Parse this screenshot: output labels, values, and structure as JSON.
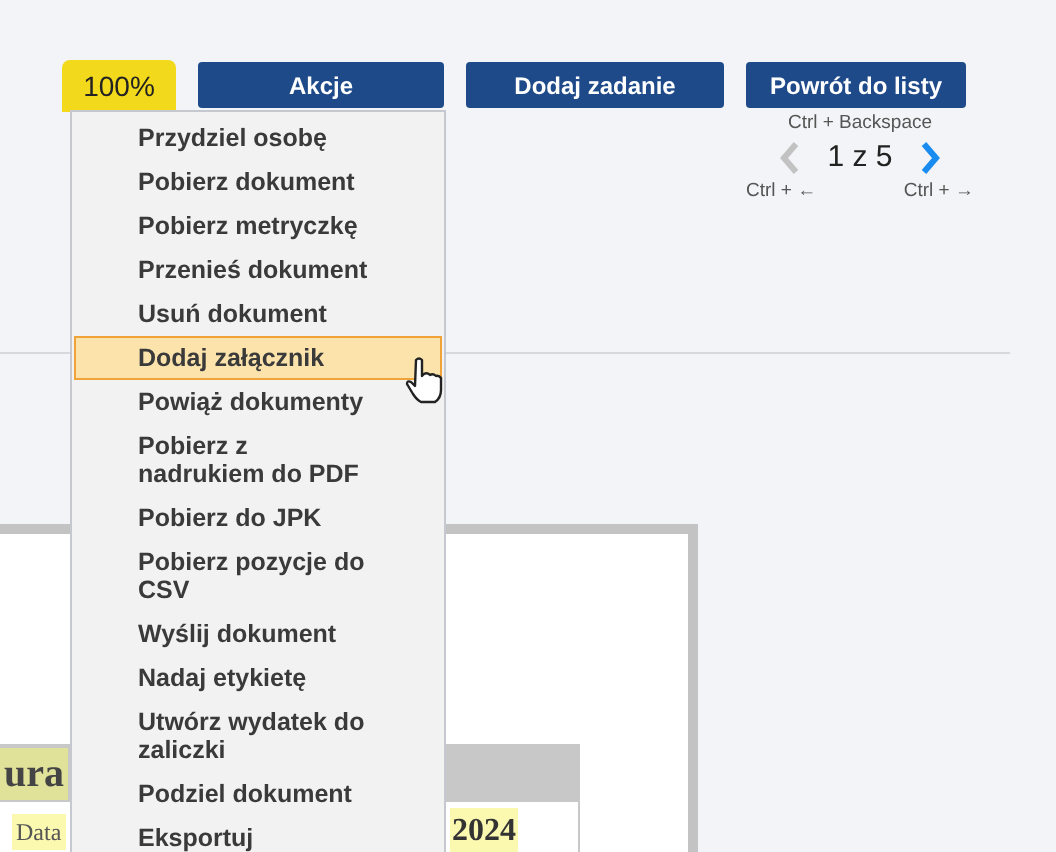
{
  "zoom": {
    "label": "100%"
  },
  "toolbar_buttons": [
    {
      "label": "Akcje"
    },
    {
      "label": "Dodaj zadanie"
    },
    {
      "label": "Powrót do listy"
    }
  ],
  "back_shortcut": "Ctrl + Backspace",
  "pager": {
    "position": "1 z 5",
    "prev": {
      "disabled": true,
      "shortcut": "Ctrl + ←"
    },
    "next": {
      "disabled": false,
      "shortcut": "Ctrl + →"
    }
  },
  "document": {
    "title": "ura",
    "date_label": "Data",
    "date_value": "2024"
  },
  "actions_menu": [
    {
      "lines": [
        "Przydziel osobę"
      ],
      "highlighted": false
    },
    {
      "lines": [
        "Pobierz dokument"
      ],
      "highlighted": false
    },
    {
      "lines": [
        "Pobierz metryczkę"
      ],
      "highlighted": false
    },
    {
      "lines": [
        "Przenieś dokument"
      ],
      "highlighted": false
    },
    {
      "lines": [
        "Usuń dokument"
      ],
      "highlighted": false
    },
    {
      "lines": [
        "Dodaj załącznik"
      ],
      "highlighted": true
    },
    {
      "lines": [
        "Powiąż dokumenty"
      ],
      "highlighted": false
    },
    {
      "lines": [
        "Pobierz z",
        "nadrukiem do PDF"
      ],
      "highlighted": false
    },
    {
      "lines": [
        "Pobierz do JPK"
      ],
      "highlighted": false
    },
    {
      "lines": [
        "Pobierz pozycje do",
        "CSV"
      ],
      "highlighted": false
    },
    {
      "lines": [
        "Wyślij dokument"
      ],
      "highlighted": false
    },
    {
      "lines": [
        "Nadaj etykietę"
      ],
      "highlighted": false
    },
    {
      "lines": [
        "Utwórz wydatek do",
        "zaliczki"
      ],
      "highlighted": false
    },
    {
      "lines": [
        "Podziel dokument"
      ],
      "highlighted": false
    },
    {
      "lines": [
        "Eksportuj"
      ],
      "highlighted": false
    }
  ]
}
